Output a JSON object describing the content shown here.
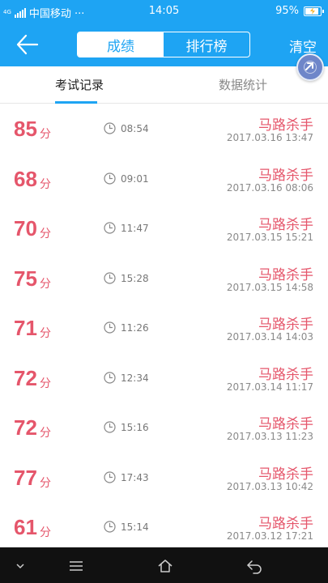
{
  "status_bar": {
    "network": "4G",
    "carrier": "中国移动 ···",
    "time": "14:05",
    "battery": "95%",
    "battery_level": 0.95
  },
  "nav": {
    "segments": [
      "成绩",
      "排行榜"
    ],
    "active_segment": 0,
    "clear_label": "清空"
  },
  "tabs": [
    "考试记录",
    "数据统计"
  ],
  "unit": "分",
  "records": [
    {
      "score": "85",
      "duration": "08:54",
      "title": "马路杀手",
      "date": "2017.03.16  13:47"
    },
    {
      "score": "68",
      "duration": "09:01",
      "title": "马路杀手",
      "date": "2017.03.16  08:06"
    },
    {
      "score": "70",
      "duration": "11:47",
      "title": "马路杀手",
      "date": "2017.03.15  15:21"
    },
    {
      "score": "75",
      "duration": "15:28",
      "title": "马路杀手",
      "date": "2017.03.15  14:58"
    },
    {
      "score": "71",
      "duration": "11:26",
      "title": "马路杀手",
      "date": "2017.03.14  14:03"
    },
    {
      "score": "72",
      "duration": "12:34",
      "title": "马路杀手",
      "date": "2017.03.14  11:17"
    },
    {
      "score": "72",
      "duration": "15:16",
      "title": "马路杀手",
      "date": "2017.03.13  11:23"
    },
    {
      "score": "77",
      "duration": "17:43",
      "title": "马路杀手",
      "date": "2017.03.13  10:42"
    },
    {
      "score": "61",
      "duration": "15:14",
      "title": "马路杀手",
      "date": "2017.03.12  17:21"
    }
  ],
  "icons": {
    "back": "arrow-left-icon",
    "clock": "clock-icon",
    "float": "assistive-touch-icon",
    "bottom": [
      "chevron-down-icon",
      "menu-icon",
      "home-icon",
      "back-icon"
    ]
  },
  "colors": {
    "primary": "#1ea4f3",
    "score": "#e5566b",
    "nav_bar": "#111111"
  }
}
